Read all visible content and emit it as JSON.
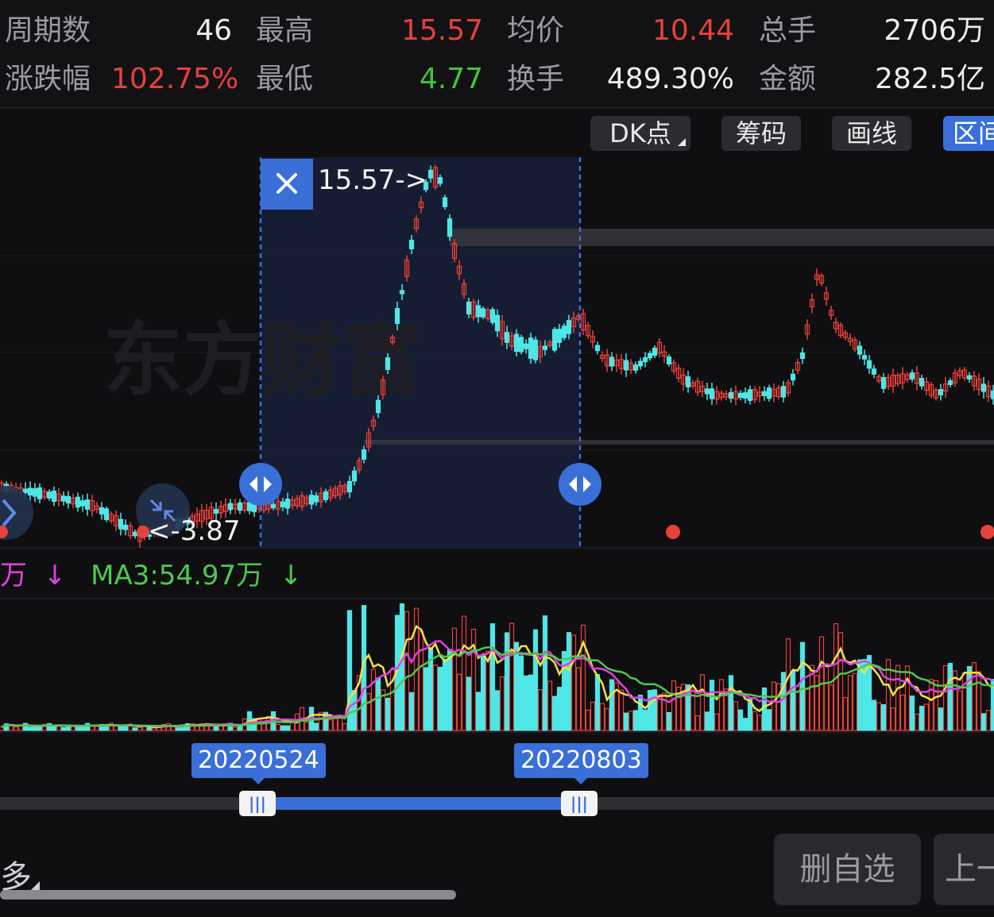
{
  "stats": {
    "row1": [
      {
        "label": "周期数",
        "value": "46",
        "color": "#ededed"
      },
      {
        "label": "最高",
        "value": "15.57",
        "color": "#e8403a"
      },
      {
        "label": "均价",
        "value": "10.44",
        "color": "#e8403a"
      },
      {
        "label": "总手",
        "value": "2706万",
        "color": "#ededed"
      }
    ],
    "row2": [
      {
        "label": "涨跌幅",
        "value": "102.75%",
        "color": "#e8403a"
      },
      {
        "label": "最低",
        "value": "4.77",
        "color": "#3fc53a"
      },
      {
        "label": "换手",
        "value": "489.30%",
        "color": "#ededed"
      },
      {
        "label": "金额",
        "value": "282.5亿",
        "color": "#ededed"
      }
    ]
  },
  "toolbar": {
    "dk": "DK点",
    "chips": "筹码",
    "draw": "画线",
    "range": "区间"
  },
  "chart": {
    "watermark": "东方财富",
    "high_label": "15.57->",
    "low_label": "<-3.87",
    "ma_legend_prefix": "万",
    "ma_legend_arrow": "↓",
    "ma3_label": "MA3:54.97万",
    "ma3_arrow": "↓"
  },
  "range": {
    "start_date": "20220524",
    "end_date": "20220803",
    "handle_glyph": "|||"
  },
  "bottom": {
    "more": "多",
    "delete_watch": "删自选",
    "prev": "上一"
  },
  "colors": {
    "up": "#e8403a",
    "down": "#4ee6e6",
    "accent": "#3a6fd8",
    "ma_yellow": "#f0e048",
    "ma_magenta": "#e040e0",
    "ma_green": "#4ec84e"
  }
}
